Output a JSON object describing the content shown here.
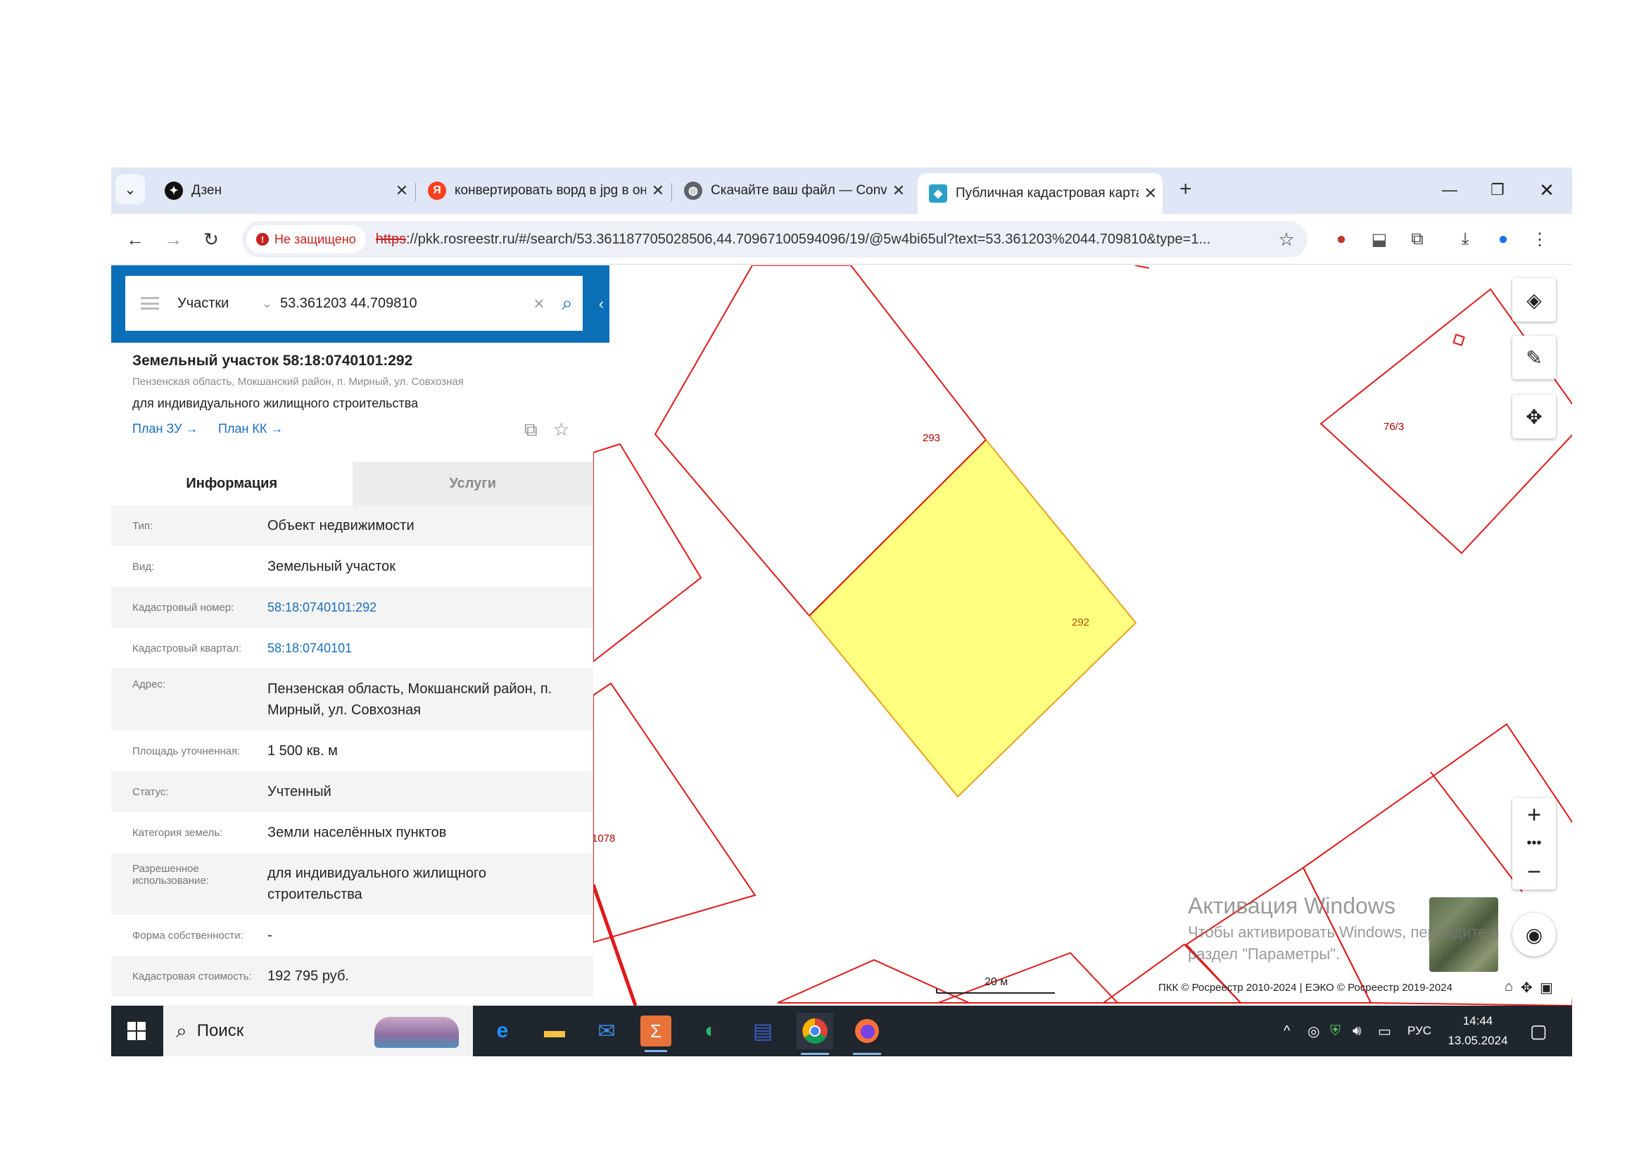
{
  "browser": {
    "tabs": [
      {
        "title": "Дзен",
        "icon": "dzen-icon"
      },
      {
        "title": "конвертировать ворд в jpg в он",
        "icon": "yandex-icon"
      },
      {
        "title": "Скачайте ваш файл — Convert",
        "icon": "globe-icon"
      },
      {
        "title": "Публичная кадастровая карта",
        "icon": "rosreestr-icon",
        "active": true
      }
    ],
    "security_label": "Не защищено",
    "url_protocol": "https",
    "url_rest": "://pkk.rosreestr.ru/#/search/53.361187705028506,44.70967100594096/19/@5w4bi65ul?text=53.361203%2044.709810&type=1..."
  },
  "search": {
    "category": "Участки",
    "query": "53.361203 44.709810"
  },
  "card": {
    "title": "Земельный участок 58:18:0740101:292",
    "address": "Пензенская область, Мокшанский район, п. Мирный, ул. Совхозная",
    "use": "для индивидуального жилищного строительства",
    "link_plan_zu": "План ЗУ →",
    "link_plan_kk": "План КК →"
  },
  "info_tabs": {
    "info": "Информация",
    "services": "Услуги"
  },
  "info_rows": [
    {
      "label": "Тип:",
      "value": "Объект недвижимости"
    },
    {
      "label": "Вид:",
      "value": "Земельный участок"
    },
    {
      "label": "Кадастровый номер:",
      "value": "58:18:0740101:292"
    },
    {
      "label": "Кадастровый квартал:",
      "value": "58:18:0740101"
    },
    {
      "label": "Адрес:",
      "value": "Пензенская область, Мокшанский район, п. Мирный, ул. Совхозная"
    },
    {
      "label": "Площадь уточненная:",
      "value": "1 500 кв. м"
    },
    {
      "label": "Статус:",
      "value": "Учтенный"
    },
    {
      "label": "Категория земель:",
      "value": "Земли населённых пунктов"
    },
    {
      "label": "Разрешенное использование:",
      "value": "для индивидуального жилищного строительства"
    },
    {
      "label": "Форма собственности:",
      "value": "-"
    },
    {
      "label": "Кадастровая стоимость:",
      "value": "192 795 руб."
    }
  ],
  "map": {
    "parcel_labels": {
      "p293": "293",
      "p292": "292",
      "p76": "76/3",
      "p1078": "1078"
    },
    "scale_label": "20 м",
    "copyright": "ПКК © Росреестр 2010-2024 | ЕЭКО © Росреестр 2019-2024",
    "watermark_title": "Активация Windows",
    "watermark_text1": "Чтобы активировать Windows, перейдите в",
    "watermark_text2": "раздел \"Параметры\".",
    "colors": {
      "border": "#e01a1a",
      "selected_fill": "#ffff80",
      "selected_border": "#e8a020"
    }
  },
  "taskbar": {
    "search_label": "Поиск",
    "lang": "РУС",
    "time": "14:44",
    "date": "13.05.2024"
  }
}
